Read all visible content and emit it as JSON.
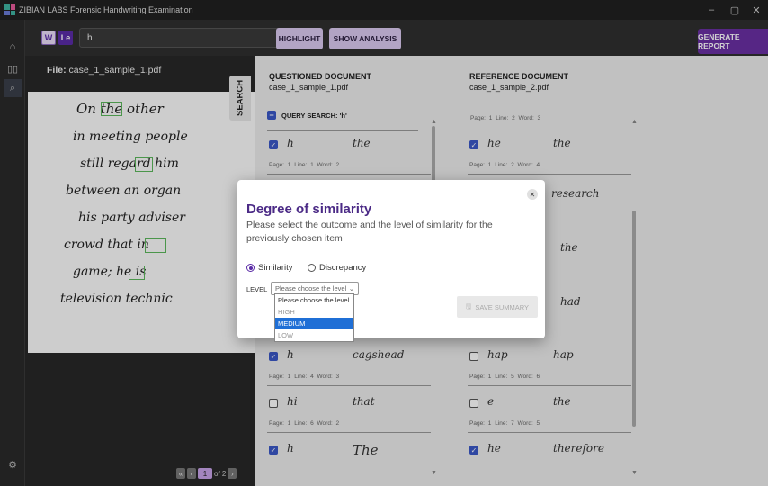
{
  "window": {
    "title": "ZIBIAN LABS Forensic Handwriting Examination",
    "minimize": "–",
    "maximize": "▢",
    "close": "✕"
  },
  "toolbar": {
    "w_label": "W",
    "le_label": "Le",
    "search_value": "h",
    "highlight_label": "HIGHLIGHT",
    "show_analysis_label": "SHOW ANALYSIS",
    "generate_report_label": "GENERATE REPORT"
  },
  "left": {
    "file_prefix": "File:",
    "file_name": "case_1_sample_1.pdf",
    "search_tab": "SEARCH",
    "lines": [
      "On the other",
      "in meeting people",
      "still regard him",
      "between an organ",
      "his party adviser",
      "crowd that in",
      "game; he is",
      "television technic"
    ],
    "pager": {
      "current": "1",
      "of": "of 2"
    }
  },
  "questioned": {
    "title": "QUESTIONED DOCUMENT",
    "file": "case_1_sample_1.pdf",
    "query": "QUERY SEARCH: 'h'",
    "rows": [
      {
        "w1": "h",
        "w2": "the",
        "meta": "Page: 1   Line: 1   Word: 2",
        "checked": true
      },
      {
        "w1": "h",
        "w2": "cagshead",
        "meta": "Page: 1   Line: 4   Word: 3",
        "checked": true
      },
      {
        "w1": "hi",
        "w2": "that",
        "meta": "Page: 1   Line: 6   Word: 2",
        "checked": false
      },
      {
        "w1": "h",
        "w2": "The",
        "meta": "",
        "checked": true
      }
    ]
  },
  "reference": {
    "title": "REFERENCE DOCUMENT",
    "file": "case_1_sample_2.pdf",
    "rows": [
      {
        "w1": "he",
        "w2": "the",
        "meta": "Page: 1   Line: 2   Word: 4",
        "checked": true,
        "meta_top": "Page: 1   Line: 2   Word: 3"
      },
      {
        "w1": "hap",
        "w2": "hap",
        "meta": "Page: 1   Line: 5   Word: 6",
        "checked": false
      },
      {
        "w1": "e",
        "w2": "the",
        "meta": "Page: 1   Line: 7   Word: 5",
        "checked": false
      },
      {
        "w1": "he",
        "w2": "therefore",
        "meta": "",
        "checked": true
      }
    ],
    "partial_words": [
      "research",
      "the",
      "had"
    ]
  },
  "dialog": {
    "title": "Degree of similarity",
    "description": "Please select the outcome and the level of similarity for the previously chosen item",
    "option_similarity": "Similarity",
    "option_discrepancy": "Discrepancy",
    "level_label": "LEVEL",
    "select_placeholder": "Please choose the level",
    "dropdown": [
      "Please choose the level",
      "HIGH",
      "MEDIUM",
      "LOW"
    ],
    "selected": "MEDIUM",
    "save_label": "SAVE SUMMARY"
  },
  "colors": {
    "accent": "#6a2fa3",
    "check": "#3a57c6",
    "highlight": "#5cb85c",
    "selected": "#1f6fd6"
  }
}
